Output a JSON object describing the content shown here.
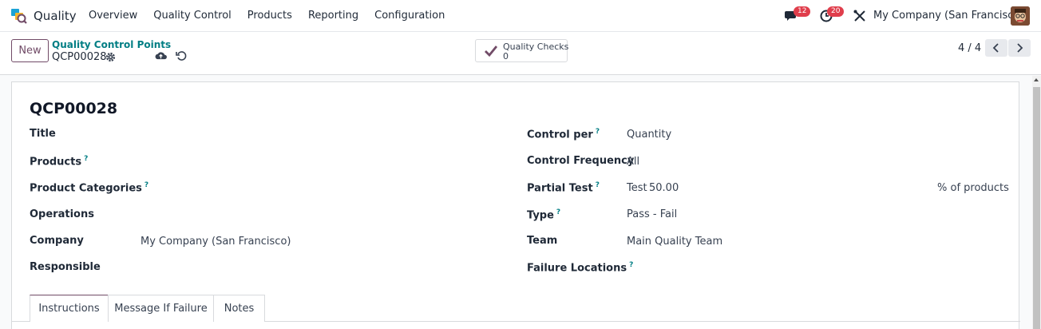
{
  "navbar": {
    "app_name": "Quality",
    "menu": [
      "Overview",
      "Quality Control",
      "Products",
      "Reporting",
      "Configuration"
    ],
    "messages_badge": "12",
    "activities_badge": "20",
    "company": "My Company (San Francisco)"
  },
  "control_panel": {
    "new_label": "New",
    "breadcrumb": "Quality Control Points",
    "record_name": "QCP00028",
    "smart_button": {
      "label": "Quality Checks",
      "count": "0"
    },
    "pager": "4 / 4"
  },
  "form": {
    "title": "QCP00028",
    "left_fields": [
      {
        "label": "Title",
        "help": "",
        "value": ""
      },
      {
        "label": "Products",
        "help": "?",
        "value": ""
      },
      {
        "label": "Product Categories",
        "help": "?",
        "value": ""
      },
      {
        "label": "Operations",
        "help": "",
        "value": ""
      },
      {
        "label": "Company",
        "help": "",
        "value": "My Company (San Francisco)"
      },
      {
        "label": "Responsible",
        "help": "",
        "value": ""
      }
    ],
    "right_fields": [
      {
        "label": "Control per",
        "help": "?",
        "value": "Quantity"
      },
      {
        "label": "Control Frequency",
        "help": "",
        "value": "All"
      },
      {
        "label": "Partial Test",
        "help": "?",
        "value": "Test",
        "value2": "50.00",
        "suffix": "% of products"
      },
      {
        "label": "Type",
        "help": "?",
        "value": "Pass - Fail"
      },
      {
        "label": "Team",
        "help": "",
        "value": "Main Quality Team"
      },
      {
        "label": "Failure Locations",
        "help": "?",
        "value": ""
      }
    ],
    "tabs": [
      "Instructions",
      "Message If Failure",
      "Notes"
    ]
  },
  "colors": {
    "brand": "#714b67",
    "accent": "#017e84",
    "badge": "#e03e4c"
  }
}
